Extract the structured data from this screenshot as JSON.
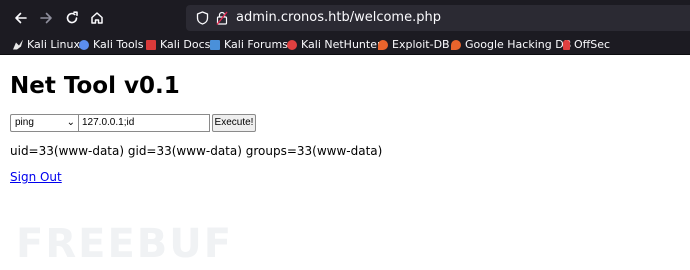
{
  "browser": {
    "url": "admin.cronos.htb/welcome.php",
    "bookmarks": [
      {
        "label": "Kali Linux",
        "icon": "kali-dragon-icon",
        "color": "#e8e8e8"
      },
      {
        "label": "Kali Tools",
        "icon": "kali-tools-icon",
        "color": "#5b8def"
      },
      {
        "label": "Kali Docs",
        "icon": "kali-docs-icon",
        "color": "#d93a3a"
      },
      {
        "label": "Kali Forums",
        "icon": "kali-forums-icon",
        "color": "#4a90d9"
      },
      {
        "label": "Kali NetHunter",
        "icon": "kali-nethunter-icon",
        "color": "#e04040"
      },
      {
        "label": "Exploit-DB",
        "icon": "exploit-db-icon",
        "color": "#e8642c"
      },
      {
        "label": "Google Hacking DB",
        "icon": "google-hacking-db-icon",
        "color": "#e8642c"
      },
      {
        "label": "OffSec",
        "icon": "offsec-icon",
        "color": "#e04040"
      }
    ]
  },
  "page": {
    "title": "Net Tool v0.1",
    "command_select": "ping",
    "host_value": "127.0.0.1;id",
    "execute_label": "Execute!",
    "output": "uid=33(www-data) gid=33(www-data) groups=33(www-data)",
    "signout_label": "Sign Out",
    "watermark": "FREEBUF"
  }
}
